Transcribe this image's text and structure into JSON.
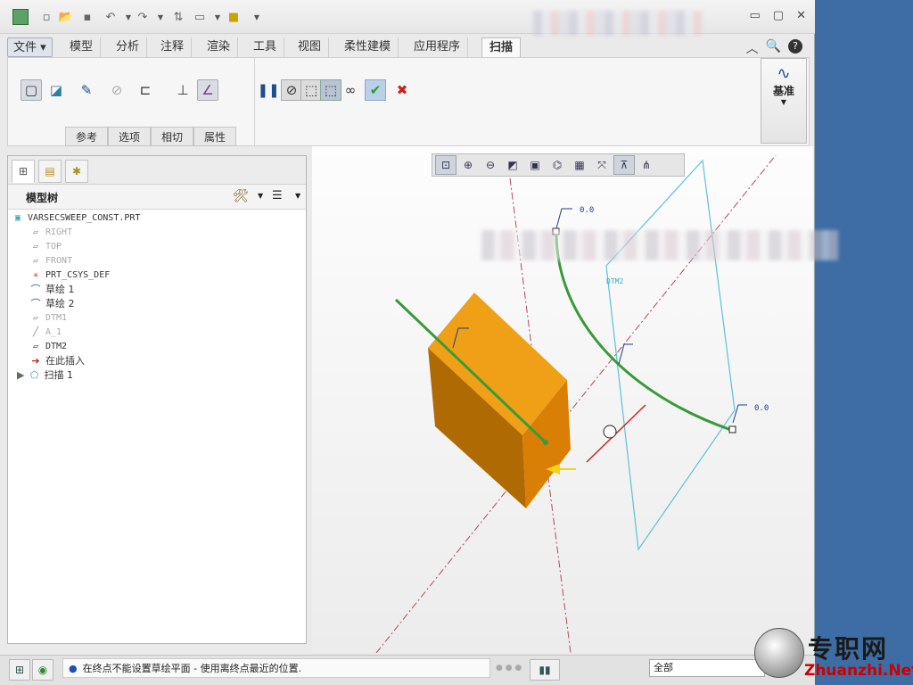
{
  "colors": {
    "accent_green": "#3a9a3a",
    "model_orange": "#e98c06",
    "plane_cyan": "#59c3d4",
    "axis_red": "#b14a55",
    "desktop": "#3d6da4"
  },
  "quick_access": {
    "icons": [
      "new-icon",
      "open-icon",
      "save-icon",
      "undo-icon",
      "redo-icon",
      "regenerate-icon",
      "windows-icon",
      "close-window-icon",
      "customize-icon"
    ]
  },
  "tabs": {
    "file": "文件",
    "items": [
      "模型",
      "分析",
      "注释",
      "渲染",
      "工具",
      "视图",
      "柔性建模",
      "应用程序"
    ],
    "active": "扫描"
  },
  "ribbon": {
    "sub_tabs": [
      "参考",
      "选项",
      "相切",
      "属性"
    ],
    "datum_label": "基准"
  },
  "model_tree": {
    "title": "模型树",
    "part": "VARSECSWEEP_CONST.PRT",
    "items": [
      {
        "label": "RIGHT",
        "dim": true
      },
      {
        "label": "TOP",
        "dim": true
      },
      {
        "label": "FRONT",
        "dim": true
      },
      {
        "label": "PRT_CSYS_DEF",
        "dim": false
      },
      {
        "label": "草绘 1",
        "dim": false
      },
      {
        "label": "草绘 2",
        "dim": false
      },
      {
        "label": "DTM1",
        "dim": true
      },
      {
        "label": "A_1",
        "dim": true
      },
      {
        "label": "DTM2",
        "dim": false
      },
      {
        "label": "在此插入",
        "dim": false
      },
      {
        "label": "扫描 1",
        "dim": false
      }
    ]
  },
  "viewport": {
    "labels": {
      "dtm2": "DTM2",
      "dim_top": "0.0",
      "dim_right": "0.0"
    }
  },
  "status": {
    "message": "在终点不能设置草绘平面 - 使用离终点最近的位置.",
    "filter": "全部"
  },
  "watermark": {
    "cn": "专职网",
    "en": "Zhuanzhi.Net"
  }
}
